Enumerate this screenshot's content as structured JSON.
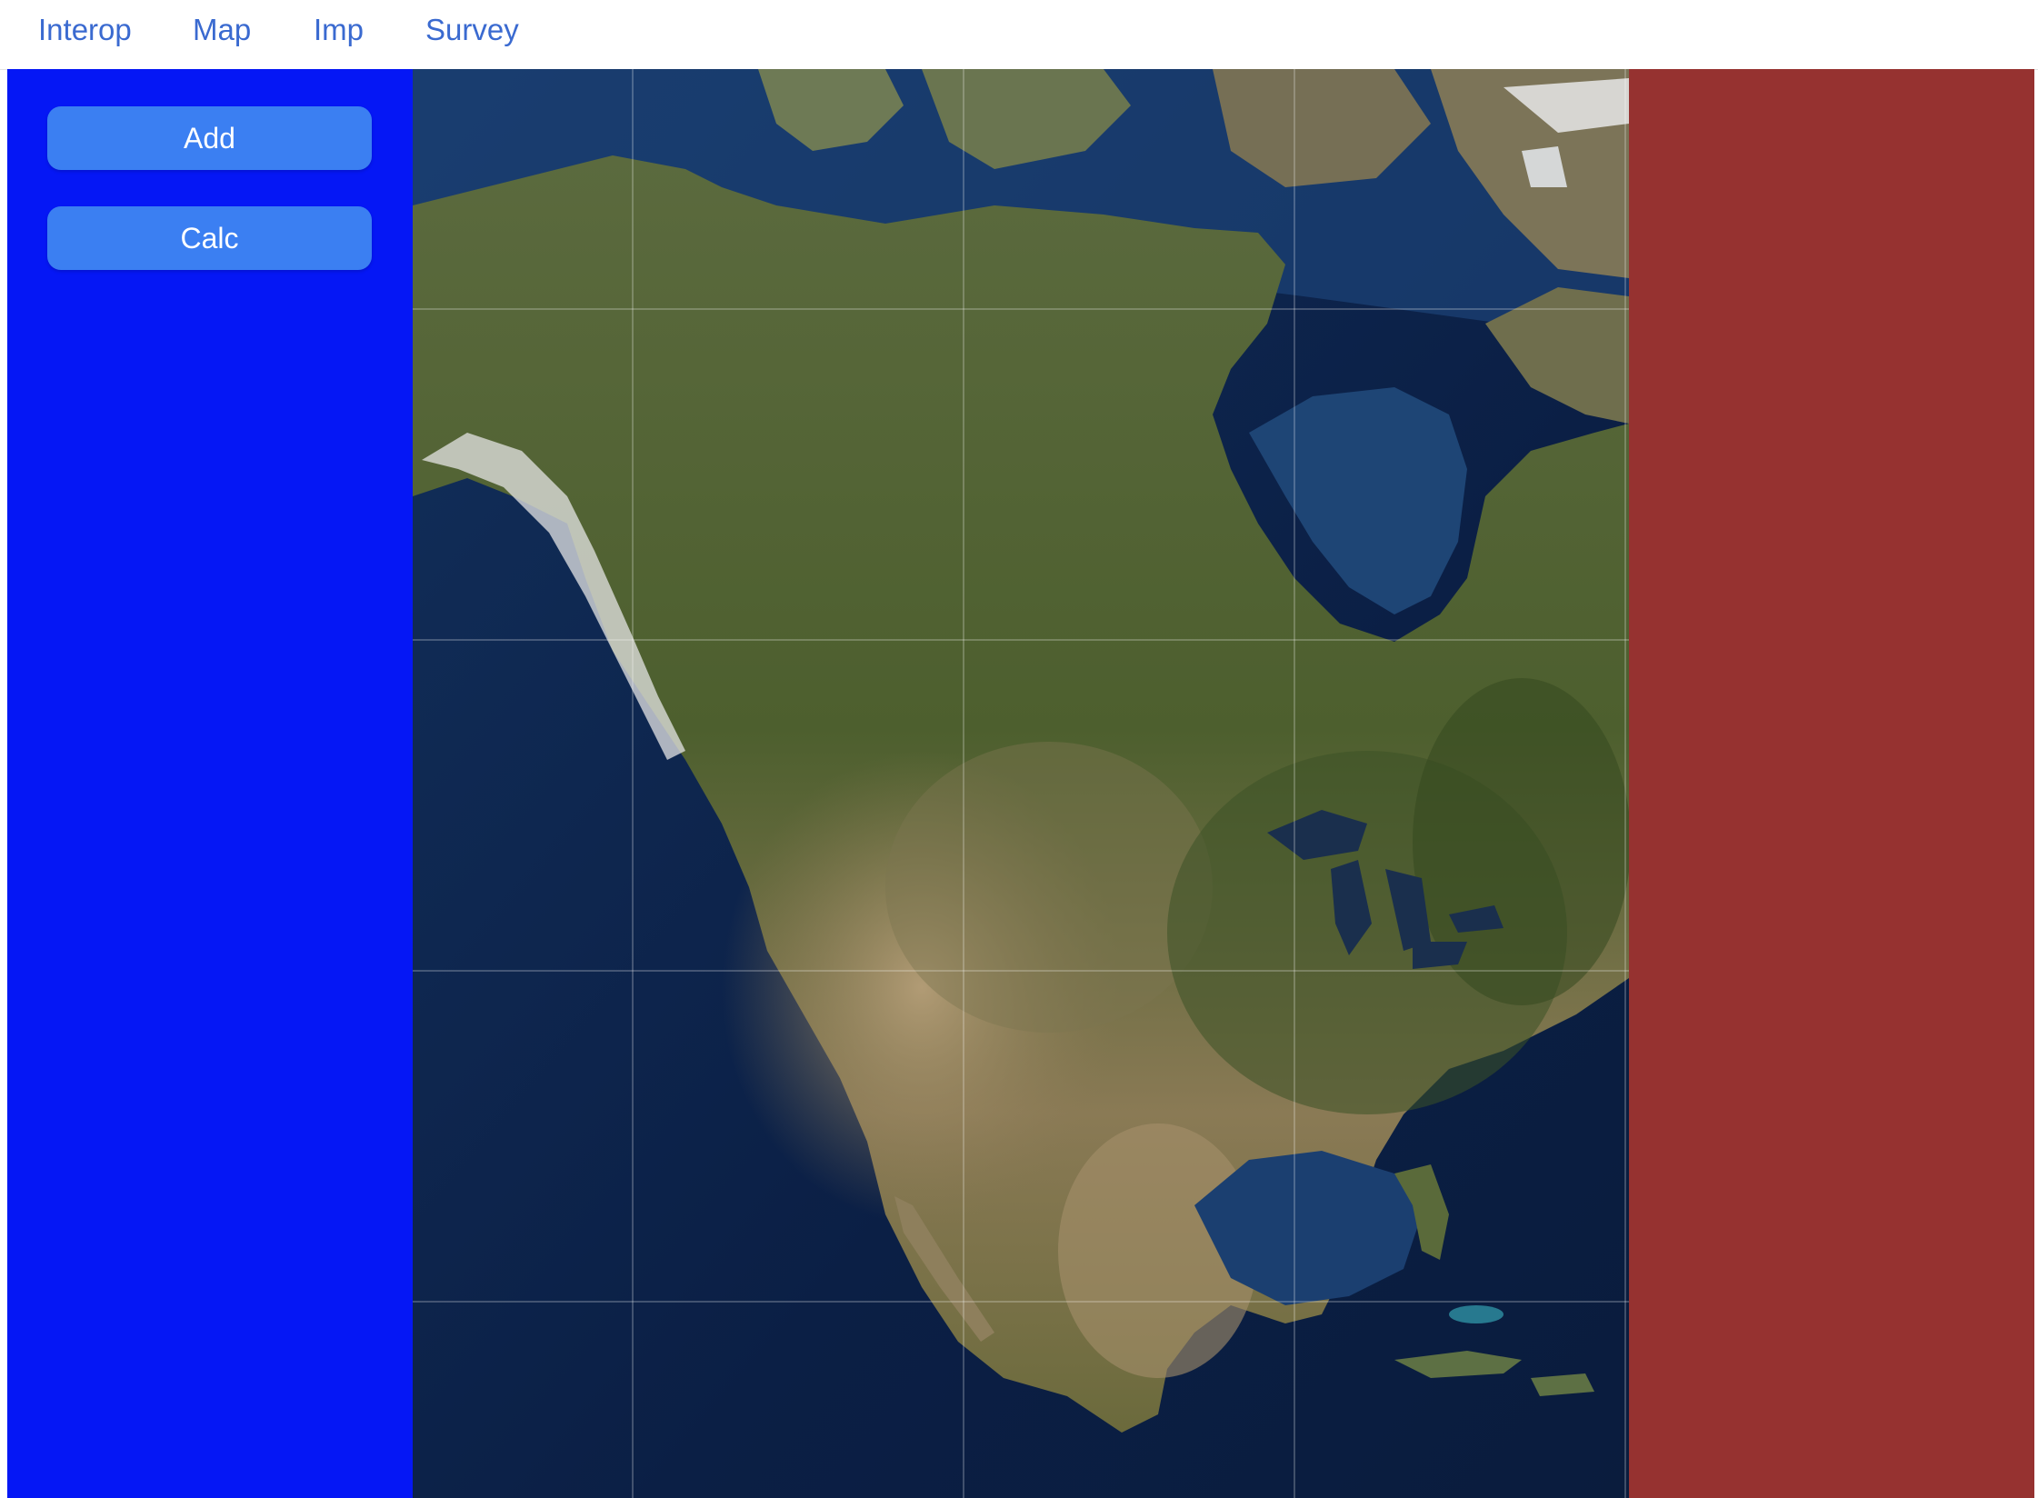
{
  "nav": {
    "items": [
      "Interop",
      "Map",
      "Imp",
      "Survey"
    ]
  },
  "sidebar": {
    "add_label": "Add",
    "calc_label": "Calc"
  },
  "map": {
    "layer": "satellite imagery",
    "grid_lines": true
  },
  "colors": {
    "sidebar": "#0517f5",
    "button": "#3b7ff2",
    "right_panel": "#963230",
    "nav_link": "#3a6ad0"
  }
}
